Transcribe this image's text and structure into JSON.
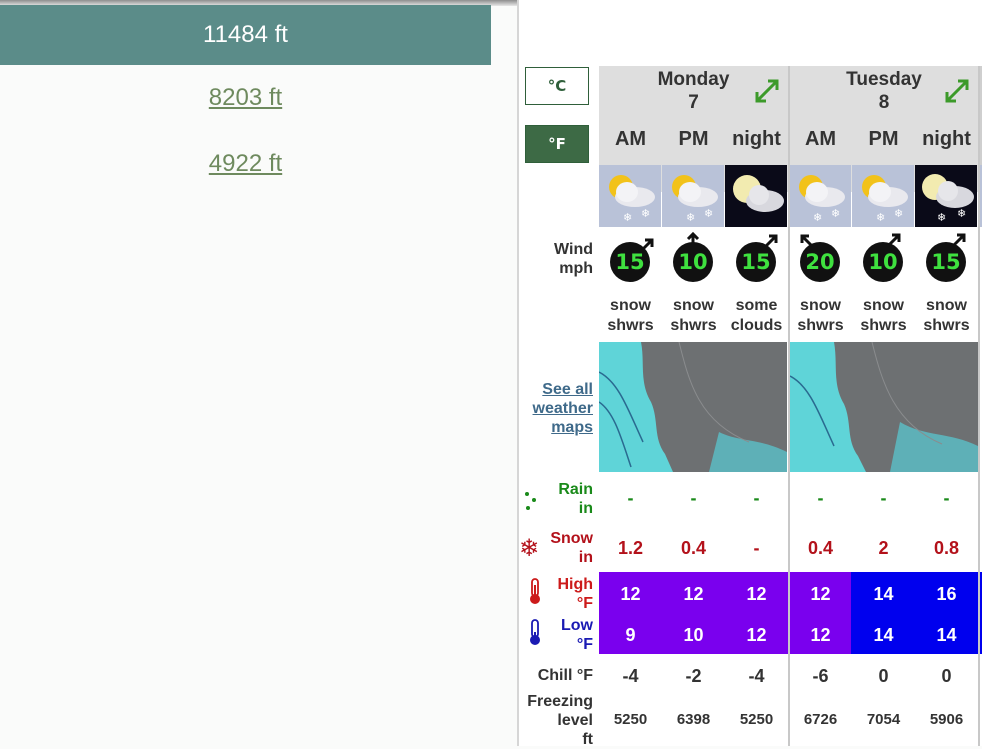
{
  "elevations": {
    "active": "11484 ft",
    "links": [
      "8203 ft",
      "4922 ft"
    ]
  },
  "units": {
    "celsius": "°C",
    "fahrenheit": "°F",
    "active": "fahrenheit"
  },
  "row_labels": {
    "wind": [
      "Wind",
      "mph"
    ],
    "rain": [
      "Rain",
      "in"
    ],
    "snow": [
      "Snow",
      "in"
    ],
    "high": [
      "High",
      "°F"
    ],
    "low": [
      "Low",
      "°F"
    ],
    "chill": "Chill °F",
    "freezing": [
      "Freezing",
      "level",
      "ft"
    ],
    "maps_link": [
      "See all",
      "weather",
      "maps"
    ]
  },
  "days": [
    {
      "name": "Monday",
      "date": "7"
    },
    {
      "name": "Tuesday",
      "date": "8"
    }
  ],
  "periods": [
    {
      "label": "AM",
      "icon": "sun-cloud-snow-icon",
      "wind_speed": "15",
      "wind_dir": "from-southwest",
      "summary": [
        "snow",
        "shwrs"
      ],
      "rain": "-",
      "snow": "1.2",
      "high": "12",
      "low": "9",
      "chill": "-4",
      "freezing": "5250"
    },
    {
      "label": "PM",
      "icon": "sun-cloud-snow-icon",
      "wind_speed": "10",
      "wind_dir": "from-south",
      "summary": [
        "snow",
        "shwrs"
      ],
      "rain": "-",
      "snow": "0.4",
      "high": "12",
      "low": "10",
      "chill": "-2",
      "freezing": "6398"
    },
    {
      "label": "night",
      "icon": "moon-cloud-icon",
      "wind_speed": "15",
      "wind_dir": "from-southwest",
      "summary": [
        "some",
        "clouds"
      ],
      "rain": "-",
      "snow": "-",
      "high": "12",
      "low": "12",
      "chill": "-4",
      "freezing": "5250"
    },
    {
      "label": "AM",
      "icon": "sun-cloud-snow-icon",
      "wind_speed": "20",
      "wind_dir": "from-southeast",
      "summary": [
        "snow",
        "shwrs"
      ],
      "rain": "-",
      "snow": "0.4",
      "high": "12",
      "low": "12",
      "chill": "-6",
      "freezing": "6726"
    },
    {
      "label": "PM",
      "icon": "sun-cloud-snow-icon",
      "wind_speed": "10",
      "wind_dir": "from-southwest",
      "summary": [
        "snow",
        "shwrs"
      ],
      "rain": "-",
      "snow": "2",
      "high": "14",
      "low": "14",
      "chill": "0",
      "freezing": "7054"
    },
    {
      "label": "night",
      "icon": "moon-cloud-snow-icon",
      "wind_speed": "15",
      "wind_dir": "from-southwest",
      "summary": [
        "snow",
        "shwrs"
      ],
      "rain": "-",
      "snow": "0.8",
      "high": "16",
      "low": "14",
      "chill": "0",
      "freezing": "5906"
    }
  ],
  "colors": {
    "accent_elev": "#5b8c89",
    "unit_active": "#3d6a45",
    "temp_purple": "#7a00ee",
    "temp_blue": "#0000ee",
    "wind_text": "#3fe13f",
    "snow_text": "#b3111a",
    "rain_text": "#1a8a1a"
  }
}
